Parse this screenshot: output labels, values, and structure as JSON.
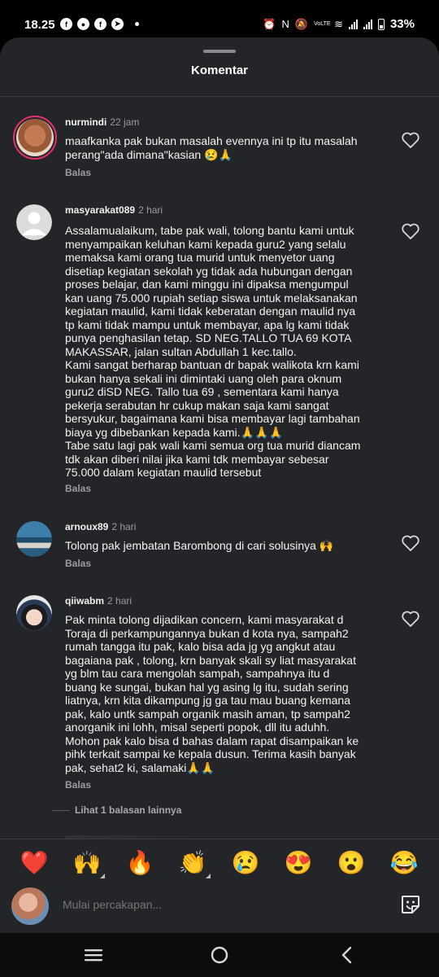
{
  "status_bar": {
    "time": "18.25",
    "left_icons": [
      "facebook-icon",
      "chat-icon",
      "facebook-icon",
      "compass-icon"
    ],
    "right_icons": [
      "alarm-icon",
      "nfc-icon",
      "mute-icon",
      "volte-icon",
      "wifi-icon",
      "signal-icon",
      "signal-icon",
      "battery-icon"
    ],
    "volte_label": "VoLTE",
    "battery": "33%"
  },
  "sheet": {
    "title": "Komentar"
  },
  "comments": [
    {
      "username": "nurmindi",
      "time": "22 jam",
      "text": "maafkanka pak bukan masalah evennya ini tp itu masalah\nperang\"ada dimana\"kasian 😢🙏",
      "reply": "Balas"
    },
    {
      "username": "masyarakat089",
      "time": "2 hari",
      "text": "Assalamualaikum, tabe pak wali, tolong bantu kami untuk\nmenyampaikan keluhan kami kepada guru2 yang selalu\nmemaksa kami orang tua murid untuk menyetor uang\ndisetiap kegiatan sekolah yg tidak ada hubungan dengan\nproses belajar, dan kami minggu ini dipaksa mengumpul\nkan uang 75.000 rupiah setiap siswa untuk melaksanakan\nkegiatan maulid, kami tidak keberatan dengan maulid nya\ntp kami tidak mampu untuk membayar, apa lg kami tidak\npunya penghasilan tetap. SD NEG.TALLO TUA 69 KOTA\nMAKASSAR, jalan sultan Abdullah 1 kec.tallo.\nKami sangat berharap bantuan dr bapak walikota krn kami\nbukan hanya sekali ini dimintaki uang oleh para oknum\nguru2 diSD NEG. Tallo tua 69 , sementara kami hanya\npekerja serabutan hr cukup makan saja kami sangat\nbersyukur, bagaimana kami bisa membayar lagi tambahan\nbiaya yg dibebankan kepada kami.🙏🙏🙏\nTabe satu lagi pak wali kami semua org tua murid diancam\ntdk akan diberi nilai jika kami tdk membayar sebesar\n75.000 dalam kegiatan maulid tersebut",
      "reply": "Balas"
    },
    {
      "username": "arnoux89",
      "time": "2 hari",
      "text": "Tolong pak jembatan Barombong di cari solusinya 🙌",
      "reply": "Balas"
    },
    {
      "username": "qiiwabm",
      "time": "2 hari",
      "text": "Pak minta tolong dijadikan concern, kami masyarakat d\nToraja di perkampungannya bukan d kota nya, sampah2\nrumah tangga itu pak, kalo bisa ada jg yg angkut atau\nbagaiana pak ,  tolong, krn banyak skali sy liat masyarakat\nyg blm tau cara mengolah sampah, sampahnya itu d\nbuang ke sungai, bukan hal yg asing lg itu, sudah sering\nliatnya, krn kita dikampung jg ga tau mau buang kemana\npak, kalo untk sampah organik masih aman, tp sampah2\nanorganik ini lohh, misal seperti popok, dll itu aduhh.\nMohon pak kalo bisa d bahas dalam rapat disampaikan ke\npihk terkait sampai ke kepala dusun. Terima kasih banyak\npak, sehat2 ki, salamaki🙏🙏",
      "reply": "Balas",
      "more_replies": "Lihat 1 balasan lainnya"
    }
  ],
  "reactions": [
    "❤️",
    "🙌",
    "🔥",
    "👏",
    "😢",
    "😍",
    "😮",
    "😂"
  ],
  "compose": {
    "placeholder": "Mulai percakapan..."
  },
  "colors": {
    "sheet_bg": "#242528",
    "accent_ring": "#e1306c",
    "muted_text": "#9a9b9f"
  }
}
